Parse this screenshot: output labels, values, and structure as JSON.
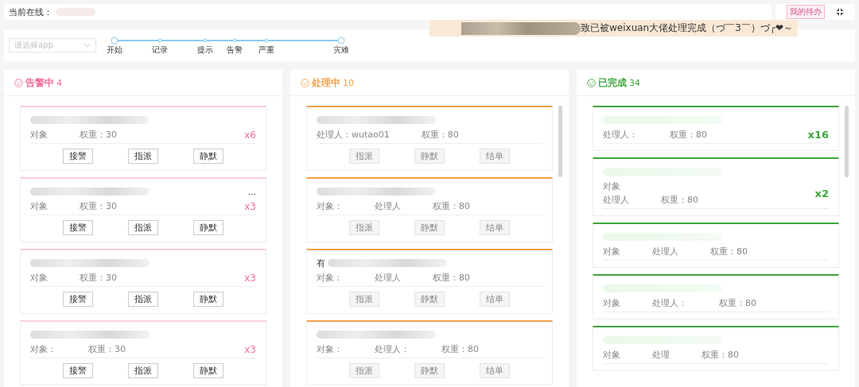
{
  "header": {
    "online_label": "当前在线：",
    "todo_tag": "我的待办"
  },
  "notice": {
    "text": "致已被weixuan大佬处理完成（づ￣3￣）づ╭❤～"
  },
  "filter": {
    "placeholder": "请选择app"
  },
  "timeline": [
    {
      "label": "开始",
      "kind": "end"
    },
    {
      "label": "记录",
      "kind": "step"
    },
    {
      "label": "提示",
      "kind": "step"
    },
    {
      "label": "告警",
      "kind": "step"
    },
    {
      "label": "严重",
      "kind": "step"
    },
    {
      "label": "灾难",
      "kind": "end"
    }
  ],
  "columns": [
    {
      "kind": "alert",
      "title": "告警中",
      "count": "4",
      "color": "#f0709a",
      "scrollbar": false,
      "cards": [
        {
          "lines": [
            [
              "对象",
              "权重：30"
            ]
          ],
          "times": "x6",
          "buttons": [
            {
              "label": "接警",
              "disabled": false
            },
            {
              "label": "指派",
              "disabled": false
            },
            {
              "label": "静默",
              "disabled": false
            }
          ]
        },
        {
          "lines": [
            [
              "对象",
              "权重：30"
            ]
          ],
          "times": "x3",
          "ellipsis": "...",
          "buttons": [
            {
              "label": "接警",
              "disabled": false
            },
            {
              "label": "指派",
              "disabled": false
            },
            {
              "label": "静默",
              "disabled": false
            }
          ]
        },
        {
          "lines": [
            [
              "对象",
              "权重：30"
            ]
          ],
          "times": "x3",
          "buttons": [
            {
              "label": "接警",
              "disabled": false
            },
            {
              "label": "指派",
              "disabled": false
            },
            {
              "label": "静默",
              "disabled": false
            }
          ]
        },
        {
          "lines": [
            [
              "对象：",
              "权重：30"
            ]
          ],
          "times": "x3",
          "buttons": [
            {
              "label": "接警",
              "disabled": false
            },
            {
              "label": "指派",
              "disabled": false
            },
            {
              "label": "静默",
              "disabled": false
            }
          ]
        }
      ]
    },
    {
      "kind": "processing",
      "title": "处理中",
      "count": "10",
      "color": "#f5a04a",
      "scrollbar": true,
      "cards": [
        {
          "lines": [
            [
              "处理人：wutao01",
              "权重：80"
            ]
          ],
          "buttons": [
            {
              "label": "指派",
              "disabled": true
            },
            {
              "label": "静默",
              "disabled": true
            },
            {
              "label": "结单",
              "disabled": true
            }
          ]
        },
        {
          "lines": [
            [
              "对象：",
              "处理人",
              "权重：80"
            ]
          ],
          "buttons": [
            {
              "label": "指派",
              "disabled": true
            },
            {
              "label": "静默",
              "disabled": true
            },
            {
              "label": "结单",
              "disabled": true
            }
          ]
        },
        {
          "title": "有",
          "lines": [
            [
              "对象：",
              "处理人",
              "权重：80"
            ]
          ],
          "buttons": [
            {
              "label": "指派",
              "disabled": true
            },
            {
              "label": "静默",
              "disabled": true
            },
            {
              "label": "结单",
              "disabled": true
            }
          ]
        },
        {
          "lines": [
            [
              "对象：",
              "处理人：",
              "权重：80"
            ]
          ],
          "buttons": [
            {
              "label": "指派",
              "disabled": true
            },
            {
              "label": "静默",
              "disabled": true
            },
            {
              "label": "结单",
              "disabled": true
            }
          ]
        }
      ]
    },
    {
      "kind": "done",
      "title": "已完成",
      "count": "34",
      "color": "#3fa53f",
      "scrollbar": true,
      "cards": [
        {
          "lines": [
            [
              "处理人：",
              "权重：80"
            ]
          ],
          "times": "x16"
        },
        {
          "lines": [
            [
              "对象"
            ],
            [
              "处理人",
              "权重：80"
            ]
          ],
          "times": "x2"
        },
        {
          "lines": [
            [
              "对象",
              "处理人",
              "权重：80"
            ]
          ]
        },
        {
          "lines": [
            [
              "对象",
              "处理人：",
              "权重：80"
            ]
          ]
        },
        {
          "lines": [
            [
              "对象",
              "处理",
              "权重：80"
            ]
          ]
        }
      ]
    }
  ]
}
